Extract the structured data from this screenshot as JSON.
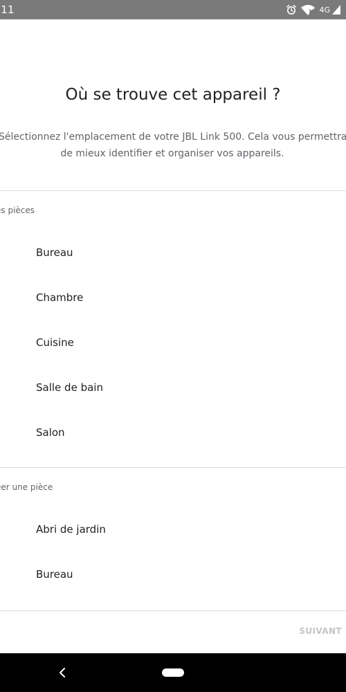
{
  "status_bar": {
    "time": ":11",
    "network": "4G",
    "icons": [
      "alarm-icon",
      "wifi-icon",
      "signal-icon"
    ]
  },
  "page": {
    "title": "Où se trouve cet appareil ?",
    "description_line1": "Sélectionnez l'emplacement de votre JBL Link 500. Cela vous permettra",
    "description_line2": "de mieux identifier et organiser vos appareils."
  },
  "sections": {
    "existing": {
      "header": "es pièces",
      "rooms": [
        "Bureau",
        "Chambre",
        "Cuisine",
        "Salle de bain",
        "Salon"
      ]
    },
    "create": {
      "header": "éer une pièce",
      "rooms": [
        "Abri de jardin",
        "Bureau"
      ]
    }
  },
  "footer": {
    "next_label": "SUIVANT"
  },
  "nav_bar": {
    "icons": [
      "back-icon",
      "home-pill"
    ]
  },
  "colors": {
    "status_bar": "#7a7a7a",
    "text_primary": "#202124",
    "text_secondary": "#5f6368",
    "divider": "#dadce0",
    "button_disabled": "#c4c4c4",
    "nav_bar": "#000000"
  }
}
